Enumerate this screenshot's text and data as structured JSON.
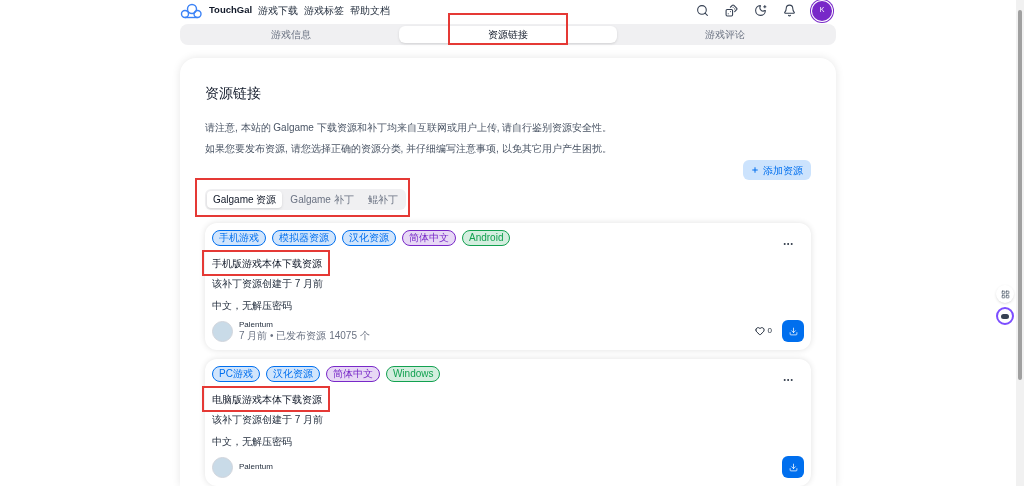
{
  "nav": {
    "brand": "TouchGal",
    "links": [
      "游戏下载",
      "游戏标签",
      "帮助文档"
    ],
    "avatar_initial": "K"
  },
  "tabs": [
    {
      "label": "游戏信息",
      "selected": false
    },
    {
      "label": "资源链接",
      "selected": true
    },
    {
      "label": "游戏评论",
      "selected": false
    }
  ],
  "section": {
    "title": "资源链接",
    "notices": [
      "请注意, 本站的 Galgame 下载资源和补丁均来自互联网或用户上传, 请自行鉴别资源安全性。",
      "如果您要发布资源, 请您选择正确的资源分类, 并仔细编写注意事项, 以免其它用户产生困扰。"
    ],
    "add_button": "添加资源",
    "subtabs": [
      {
        "label": "Galgame 资源",
        "selected": true
      },
      {
        "label": "Galgame 补丁",
        "selected": false
      },
      {
        "label": "鲲补丁",
        "selected": false
      }
    ],
    "resources": [
      {
        "tags": [
          {
            "label": "手机游戏",
            "color": "#006fee"
          },
          {
            "label": "模拟器资源",
            "color": "#006fee"
          },
          {
            "label": "汉化资源",
            "color": "#006fee"
          },
          {
            "label": "简体中文",
            "color": "#7828c8"
          },
          {
            "label": "Android",
            "color": "#12a150"
          }
        ],
        "title": "手机版游戏本体下载资源",
        "created": "该补丁资源创建于 7 月前",
        "description": "中文，无解压密码",
        "user": {
          "name": "Palentum",
          "meta": "7 月前 • 已发布资源 14075 个"
        },
        "likes": "0"
      },
      {
        "tags": [
          {
            "label": "PC游戏",
            "color": "#006fee"
          },
          {
            "label": "汉化资源",
            "color": "#006fee"
          },
          {
            "label": "简体中文",
            "color": "#7828c8"
          },
          {
            "label": "Windows",
            "color": "#12a150"
          }
        ],
        "title": "电脑版游戏本体下载资源",
        "created": "该补丁资源创建于 7 月前",
        "description": "中文，无解压密码",
        "user": {
          "name": "Palentum"
        }
      }
    ]
  }
}
